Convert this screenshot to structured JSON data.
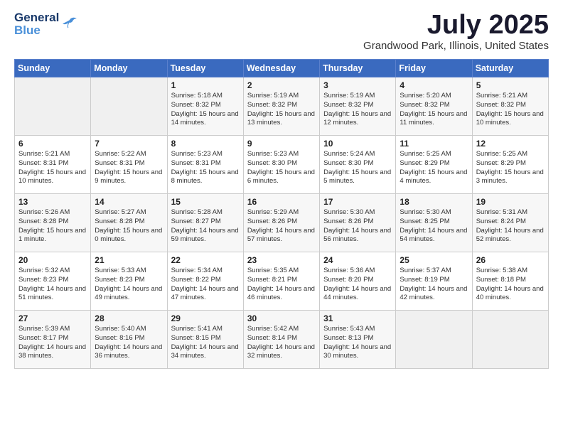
{
  "logo": {
    "line1": "General",
    "line2": "Blue"
  },
  "title": "July 2025",
  "location": "Grandwood Park, Illinois, United States",
  "days_of_week": [
    "Sunday",
    "Monday",
    "Tuesday",
    "Wednesday",
    "Thursday",
    "Friday",
    "Saturday"
  ],
  "weeks": [
    [
      {
        "day": "",
        "info": ""
      },
      {
        "day": "",
        "info": ""
      },
      {
        "day": "1",
        "info": "Sunrise: 5:18 AM\nSunset: 8:32 PM\nDaylight: 15 hours and 14 minutes."
      },
      {
        "day": "2",
        "info": "Sunrise: 5:19 AM\nSunset: 8:32 PM\nDaylight: 15 hours and 13 minutes."
      },
      {
        "day": "3",
        "info": "Sunrise: 5:19 AM\nSunset: 8:32 PM\nDaylight: 15 hours and 12 minutes."
      },
      {
        "day": "4",
        "info": "Sunrise: 5:20 AM\nSunset: 8:32 PM\nDaylight: 15 hours and 11 minutes."
      },
      {
        "day": "5",
        "info": "Sunrise: 5:21 AM\nSunset: 8:32 PM\nDaylight: 15 hours and 10 minutes."
      }
    ],
    [
      {
        "day": "6",
        "info": "Sunrise: 5:21 AM\nSunset: 8:31 PM\nDaylight: 15 hours and 10 minutes."
      },
      {
        "day": "7",
        "info": "Sunrise: 5:22 AM\nSunset: 8:31 PM\nDaylight: 15 hours and 9 minutes."
      },
      {
        "day": "8",
        "info": "Sunrise: 5:23 AM\nSunset: 8:31 PM\nDaylight: 15 hours and 8 minutes."
      },
      {
        "day": "9",
        "info": "Sunrise: 5:23 AM\nSunset: 8:30 PM\nDaylight: 15 hours and 6 minutes."
      },
      {
        "day": "10",
        "info": "Sunrise: 5:24 AM\nSunset: 8:30 PM\nDaylight: 15 hours and 5 minutes."
      },
      {
        "day": "11",
        "info": "Sunrise: 5:25 AM\nSunset: 8:29 PM\nDaylight: 15 hours and 4 minutes."
      },
      {
        "day": "12",
        "info": "Sunrise: 5:25 AM\nSunset: 8:29 PM\nDaylight: 15 hours and 3 minutes."
      }
    ],
    [
      {
        "day": "13",
        "info": "Sunrise: 5:26 AM\nSunset: 8:28 PM\nDaylight: 15 hours and 1 minute."
      },
      {
        "day": "14",
        "info": "Sunrise: 5:27 AM\nSunset: 8:28 PM\nDaylight: 15 hours and 0 minutes."
      },
      {
        "day": "15",
        "info": "Sunrise: 5:28 AM\nSunset: 8:27 PM\nDaylight: 14 hours and 59 minutes."
      },
      {
        "day": "16",
        "info": "Sunrise: 5:29 AM\nSunset: 8:26 PM\nDaylight: 14 hours and 57 minutes."
      },
      {
        "day": "17",
        "info": "Sunrise: 5:30 AM\nSunset: 8:26 PM\nDaylight: 14 hours and 56 minutes."
      },
      {
        "day": "18",
        "info": "Sunrise: 5:30 AM\nSunset: 8:25 PM\nDaylight: 14 hours and 54 minutes."
      },
      {
        "day": "19",
        "info": "Sunrise: 5:31 AM\nSunset: 8:24 PM\nDaylight: 14 hours and 52 minutes."
      }
    ],
    [
      {
        "day": "20",
        "info": "Sunrise: 5:32 AM\nSunset: 8:23 PM\nDaylight: 14 hours and 51 minutes."
      },
      {
        "day": "21",
        "info": "Sunrise: 5:33 AM\nSunset: 8:23 PM\nDaylight: 14 hours and 49 minutes."
      },
      {
        "day": "22",
        "info": "Sunrise: 5:34 AM\nSunset: 8:22 PM\nDaylight: 14 hours and 47 minutes."
      },
      {
        "day": "23",
        "info": "Sunrise: 5:35 AM\nSunset: 8:21 PM\nDaylight: 14 hours and 46 minutes."
      },
      {
        "day": "24",
        "info": "Sunrise: 5:36 AM\nSunset: 8:20 PM\nDaylight: 14 hours and 44 minutes."
      },
      {
        "day": "25",
        "info": "Sunrise: 5:37 AM\nSunset: 8:19 PM\nDaylight: 14 hours and 42 minutes."
      },
      {
        "day": "26",
        "info": "Sunrise: 5:38 AM\nSunset: 8:18 PM\nDaylight: 14 hours and 40 minutes."
      }
    ],
    [
      {
        "day": "27",
        "info": "Sunrise: 5:39 AM\nSunset: 8:17 PM\nDaylight: 14 hours and 38 minutes."
      },
      {
        "day": "28",
        "info": "Sunrise: 5:40 AM\nSunset: 8:16 PM\nDaylight: 14 hours and 36 minutes."
      },
      {
        "day": "29",
        "info": "Sunrise: 5:41 AM\nSunset: 8:15 PM\nDaylight: 14 hours and 34 minutes."
      },
      {
        "day": "30",
        "info": "Sunrise: 5:42 AM\nSunset: 8:14 PM\nDaylight: 14 hours and 32 minutes."
      },
      {
        "day": "31",
        "info": "Sunrise: 5:43 AM\nSunset: 8:13 PM\nDaylight: 14 hours and 30 minutes."
      },
      {
        "day": "",
        "info": ""
      },
      {
        "day": "",
        "info": ""
      }
    ]
  ]
}
